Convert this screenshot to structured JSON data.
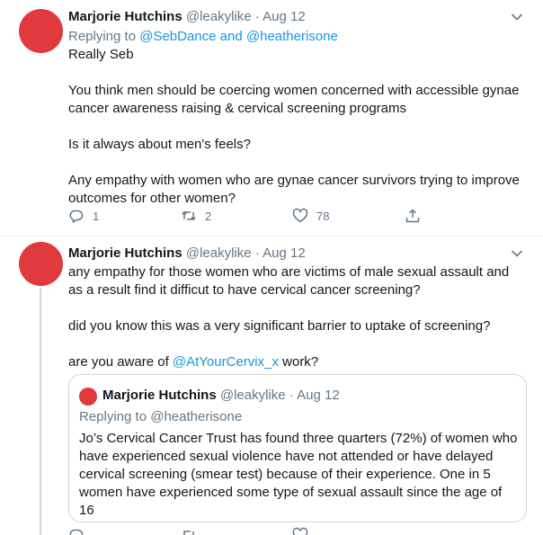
{
  "tweets": [
    {
      "author_name": "Marjorie Hutchins",
      "handle": "@leakylike",
      "separator": "·",
      "date": "Aug 12",
      "replying_prefix": "Replying to",
      "replying_to_1": "@SebDance",
      "replying_and": "and",
      "replying_to_2": "@heatherisone",
      "paragraphs": [
        "Really Seb",
        "You think men should be coercing women concerned with accessible gynae cancer awareness raising & cervical screening programs",
        "Is it always about men's feels?",
        "Any empathy with women who are gynae cancer survivors trying to improve outcomes for other women?"
      ],
      "reply_count": "1",
      "retweet_count": "2",
      "like_count": "78"
    },
    {
      "author_name": "Marjorie Hutchins",
      "handle": "@leakylike",
      "separator": "·",
      "date": "Aug 12",
      "paragraphs": [
        "any empathy for those women who are victims of male sexual assault and as a result find it difficut to have cervical cancer screening?",
        "did you know this was a very significant barrier to uptake of screening?"
      ],
      "aware_prefix": "are you aware of",
      "aware_mention": "@AtYourCervix_x",
      "aware_suffix": "work?",
      "quote": {
        "author_name": "Marjorie Hutchins",
        "handle": "@leakylike",
        "separator": "·",
        "date": "Aug 12",
        "replying_prefix": "Replying to",
        "replying_to": "@heatherisone",
        "text": "Jo’s Cervical Cancer Trust has found three quarters (72%) of women who have experienced sexual violence have not attended or have delayed cervical screening (smear test) because of their experience. One in 5 women have experienced some type of sexual assault since the age of 16"
      }
    }
  ],
  "icons": {
    "menu": "chevron-down-icon",
    "reply": "reply-icon",
    "retweet": "retweet-icon",
    "like": "heart-icon",
    "share": "share-icon"
  },
  "colors": {
    "avatar": "#e0393e",
    "link": "#1b95e0",
    "muted": "#657786",
    "text": "#14171a",
    "border": "#ccd6dd"
  }
}
